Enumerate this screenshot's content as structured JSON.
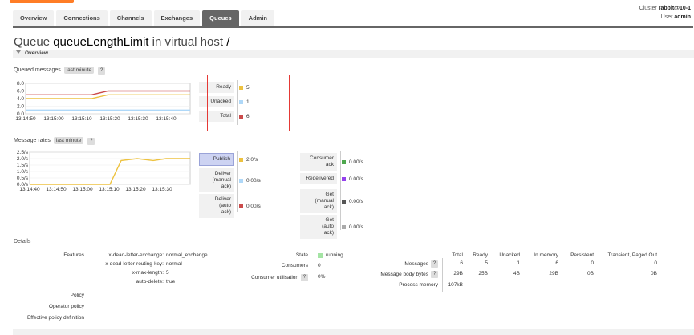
{
  "header": {
    "cluster_label": "Cluster",
    "cluster_name": "rabbit@10-1",
    "user_label": "User",
    "user_name": "admin",
    "nav": [
      "Overview",
      "Connections",
      "Channels",
      "Exchanges",
      "Queues",
      "Admin"
    ],
    "active_nav": "Queues"
  },
  "title": {
    "prefix": "Queue",
    "queue_name": "queueLengthLimit",
    "middle": "in virtual host",
    "vhost": "/"
  },
  "overview": {
    "section_label": "Overview",
    "queued_messages_label": "Queued messages",
    "queued_range": "last minute",
    "message_rates_label": "Message rates",
    "rates_range": "last minute",
    "help": "?"
  },
  "queued_legend": [
    {
      "label": "Ready",
      "value": "5",
      "color": "#edc240"
    },
    {
      "label": "Unacked",
      "value": "1",
      "color": "#afd8f8"
    },
    {
      "label": "Total",
      "value": "6",
      "color": "#cb4b4b"
    }
  ],
  "rates_legend_left": [
    {
      "label": "Publish",
      "value": "2.0/s",
      "color": "#edc240",
      "highlight": true
    },
    {
      "label": "Deliver (manual ack)",
      "value": "0.00/s",
      "color": "#afd8f8"
    },
    {
      "label": "Deliver (auto ack)",
      "value": "0.00/s",
      "color": "#cb4b4b"
    }
  ],
  "rates_legend_right": [
    {
      "label": "Consumer ack",
      "value": "0.00/s",
      "color": "#4da74d"
    },
    {
      "label": "Redelivered",
      "value": "0.00/s",
      "color": "#9440ed"
    },
    {
      "label": "Get (manual ack)",
      "value": "0.00/s",
      "color": "#555555"
    },
    {
      "label": "Get (auto ack)",
      "value": "0.00/s",
      "color": "#aaaaaa"
    }
  ],
  "chart_data": [
    {
      "type": "line",
      "title": "Queued messages",
      "x": [
        "13:14:50",
        "13:15:00",
        "13:15:10",
        "13:15:20",
        "13:15:30",
        "13:15:40"
      ],
      "ylim": [
        0,
        8
      ],
      "yticks": [
        "8.0",
        "6.0",
        "4.0",
        "2.0",
        "0.0"
      ],
      "series": [
        {
          "name": "Ready",
          "color": "#edc240",
          "points": [
            [
              0,
              4
            ],
            [
              0.4,
              4
            ],
            [
              0.5,
              5
            ],
            [
              1,
              5
            ]
          ]
        },
        {
          "name": "Unacked",
          "color": "#afd8f8",
          "points": [
            [
              0,
              1
            ],
            [
              1,
              1
            ]
          ]
        },
        {
          "name": "Total",
          "color": "#cb4b4b",
          "points": [
            [
              0,
              5
            ],
            [
              0.4,
              5
            ],
            [
              0.5,
              6
            ],
            [
              1,
              6
            ]
          ]
        }
      ]
    },
    {
      "type": "line",
      "title": "Message rates",
      "x": [
        "13:14:40",
        "13:14:50",
        "13:15:00",
        "13:15:10",
        "13:15:20",
        "13:15:30"
      ],
      "ylim": [
        0,
        2.5
      ],
      "yticks": [
        "2.5/s",
        "2.0/s",
        "1.5/s",
        "1.0/s",
        "0.5/s",
        "0.0/s"
      ],
      "series": [
        {
          "name": "Publish",
          "color": "#edc240",
          "points": [
            [
              0,
              0
            ],
            [
              0.5,
              0
            ],
            [
              0.57,
              1.85
            ],
            [
              0.67,
              2.0
            ],
            [
              0.77,
              1.85
            ],
            [
              0.85,
              2.0
            ],
            [
              1,
              2.0
            ]
          ]
        }
      ]
    }
  ],
  "details": {
    "section_label": "Details",
    "features_label": "Features",
    "features": [
      {
        "key": "x-dead-letter-exchange:",
        "value": "normal_exchange"
      },
      {
        "key": "x-dead-letter-routing-key:",
        "value": "normal"
      },
      {
        "key": "x-max-length:",
        "value": "5"
      },
      {
        "key": "auto-delete:",
        "value": "true"
      }
    ],
    "policy_label": "Policy",
    "operator_policy_label": "Operator policy",
    "effective_policy_label": "Effective policy definition",
    "state_label": "State",
    "state_value": "running",
    "state_color": "#a4e4a4",
    "consumers_label": "Consumers",
    "consumers_value": "0",
    "utilisation_label": "Consumer utilisation",
    "utilisation_value": "0%",
    "stats_headers": [
      "Total",
      "Ready",
      "Unacked",
      "In memory",
      "Persistent",
      "Transient, Paged Out"
    ],
    "stats_rows": [
      {
        "label": "Messages",
        "values": [
          "6",
          "5",
          "1",
          "6",
          "0",
          "0"
        ]
      },
      {
        "label": "Message body bytes",
        "values": [
          "29B",
          "25B",
          "4B",
          "29B",
          "0B",
          "0B"
        ]
      },
      {
        "label": "Process memory",
        "values": [
          "107kB",
          "",
          "",
          "",
          "",
          ""
        ]
      }
    ]
  }
}
